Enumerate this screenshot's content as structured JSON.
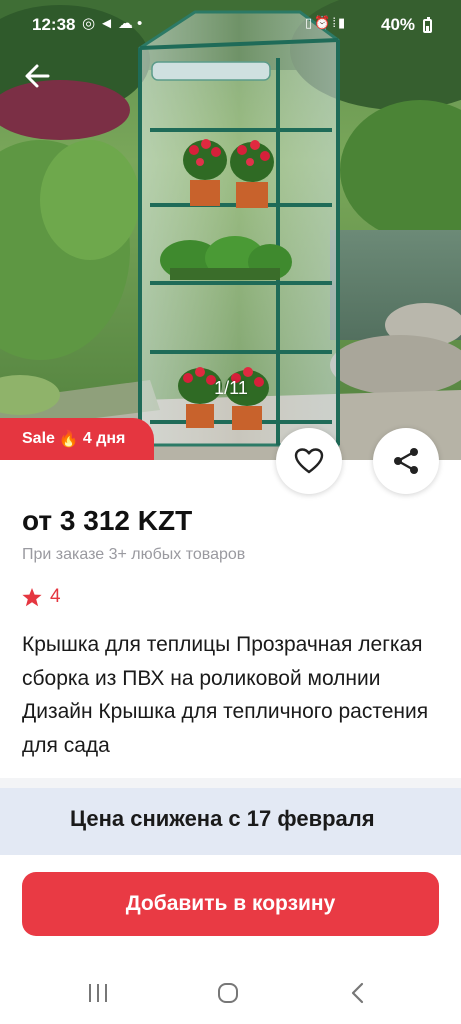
{
  "status_bar": {
    "time": "12:38",
    "battery_text": "40%",
    "icons_left": [
      "whatsapp-icon",
      "telegram-icon",
      "cloud-icon",
      "dot-icon"
    ],
    "icons_right": [
      "battery-saver-icon",
      "alarm-icon",
      "volte-icon",
      "signal-icon"
    ]
  },
  "gallery": {
    "counter": "1/11"
  },
  "sale_badge": {
    "label": "Sale",
    "duration": "4 дня",
    "icon": "flame-icon"
  },
  "product": {
    "price": "от 3 312 KZT",
    "price_note": "При заказе 3+ любых товаров",
    "rating": "4",
    "title": "Крышка для теплицы Прозрачная легкая сборка из ПВХ на роликовой молнии Дизайн Крышка для тепличного растения для сада"
  },
  "banner": {
    "text": "Цена снижена с 17 февраля"
  },
  "actions": {
    "add_to_cart": "Добавить в корзину"
  },
  "colors": {
    "accent": "#e93a44",
    "banner_bg": "#e3e9f4",
    "muted_text": "#9a9aa0"
  }
}
